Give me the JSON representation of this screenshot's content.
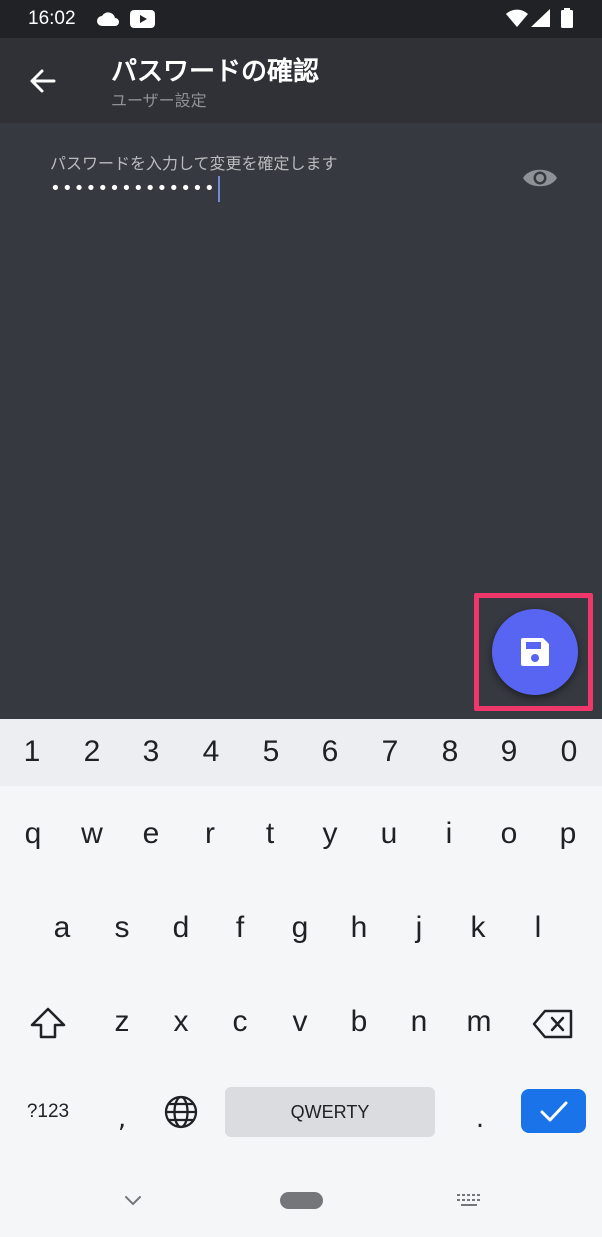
{
  "status_bar": {
    "time": "16:02",
    "icons": [
      "cloud-icon",
      "youtube-icon",
      "wifi-icon",
      "signal-icon",
      "battery-icon"
    ]
  },
  "app_bar": {
    "title": "パスワードの確認",
    "subtitle": "ユーザー設定",
    "back_icon": "arrow-left-icon"
  },
  "password_field": {
    "label": "パスワードを入力して変更を確定します",
    "value": "••••••••••••••",
    "visibility_icon": "eye-icon"
  },
  "fab": {
    "icon": "save-floppy-icon",
    "highlight_color": "#f0376b",
    "color": "#5865f2"
  },
  "keyboard": {
    "number_row": [
      "1",
      "2",
      "3",
      "4",
      "5",
      "6",
      "7",
      "8",
      "9",
      "0"
    ],
    "row1": [
      "q",
      "w",
      "e",
      "r",
      "t",
      "y",
      "u",
      "i",
      "o",
      "p"
    ],
    "row2": [
      "a",
      "s",
      "d",
      "f",
      "g",
      "h",
      "j",
      "k",
      "l"
    ],
    "row3": [
      "z",
      "x",
      "c",
      "v",
      "b",
      "n",
      "m"
    ],
    "symbols_label": "?123",
    "comma": ",",
    "space_label": "QWERTY",
    "period": ".",
    "enter_color": "#1a73e8"
  },
  "colors": {
    "background": "#36393f",
    "app_bar": "#2f3136",
    "status_bar": "#202225"
  }
}
